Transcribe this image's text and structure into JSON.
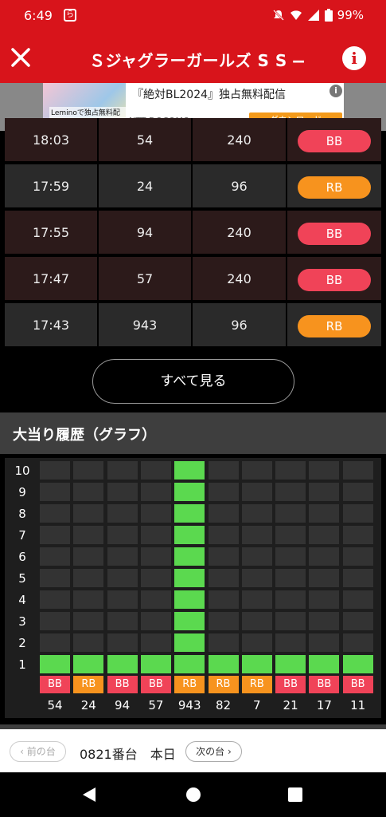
{
  "status_bar": {
    "time": "6:49",
    "notif_glyph": "ら",
    "battery": "99%"
  },
  "header": {
    "title": "Ｓジャグラーガールズ S S ―...",
    "close_icon": "close-icon",
    "info_icon": "info-icon"
  },
  "ad": {
    "thumb_caption": "Leminoで独占無料配信",
    "headline": "『絶対BL2024』独占無料配信",
    "sponsor": "NTT DOCOMO",
    "cta_label": "ダウンロード",
    "info_glyph": "i"
  },
  "history": {
    "rows": [
      {
        "time": "18:03",
        "games": "54",
        "payout": "240",
        "type": "BB"
      },
      {
        "time": "17:59",
        "games": "24",
        "payout": "96",
        "type": "RB"
      },
      {
        "time": "17:55",
        "games": "94",
        "payout": "240",
        "type": "BB"
      },
      {
        "time": "17:47",
        "games": "57",
        "payout": "240",
        "type": "BB"
      },
      {
        "time": "17:43",
        "games": "943",
        "payout": "96",
        "type": "RB"
      }
    ],
    "see_all_label": "すべて見る"
  },
  "graph_section": {
    "title": "大当り履歴（グラフ）",
    "y_labels": [
      "10",
      "9",
      "8",
      "7",
      "6",
      "5",
      "4",
      "3",
      "2",
      "1"
    ],
    "max_level": 10,
    "columns": [
      {
        "type": "BB",
        "value": "54",
        "level": 1
      },
      {
        "type": "RB",
        "value": "24",
        "level": 1
      },
      {
        "type": "BB",
        "value": "94",
        "level": 1
      },
      {
        "type": "BB",
        "value": "57",
        "level": 1
      },
      {
        "type": "RB",
        "value": "943",
        "level": 10
      },
      {
        "type": "RB",
        "value": "82",
        "level": 1
      },
      {
        "type": "RB",
        "value": "7",
        "level": 1
      },
      {
        "type": "BB",
        "value": "21",
        "level": 1
      },
      {
        "type": "BB",
        "value": "17",
        "level": 1
      },
      {
        "type": "BB",
        "value": "11",
        "level": 1
      }
    ]
  },
  "machine_nav": {
    "prev_label": "前の台",
    "machine_label": "0821番台　本日",
    "next_label": "次の台"
  },
  "colors": {
    "brand_red": "#d8141b",
    "bb": "#f04358",
    "rb": "#f7931e",
    "bar_on": "#5bd94f"
  }
}
